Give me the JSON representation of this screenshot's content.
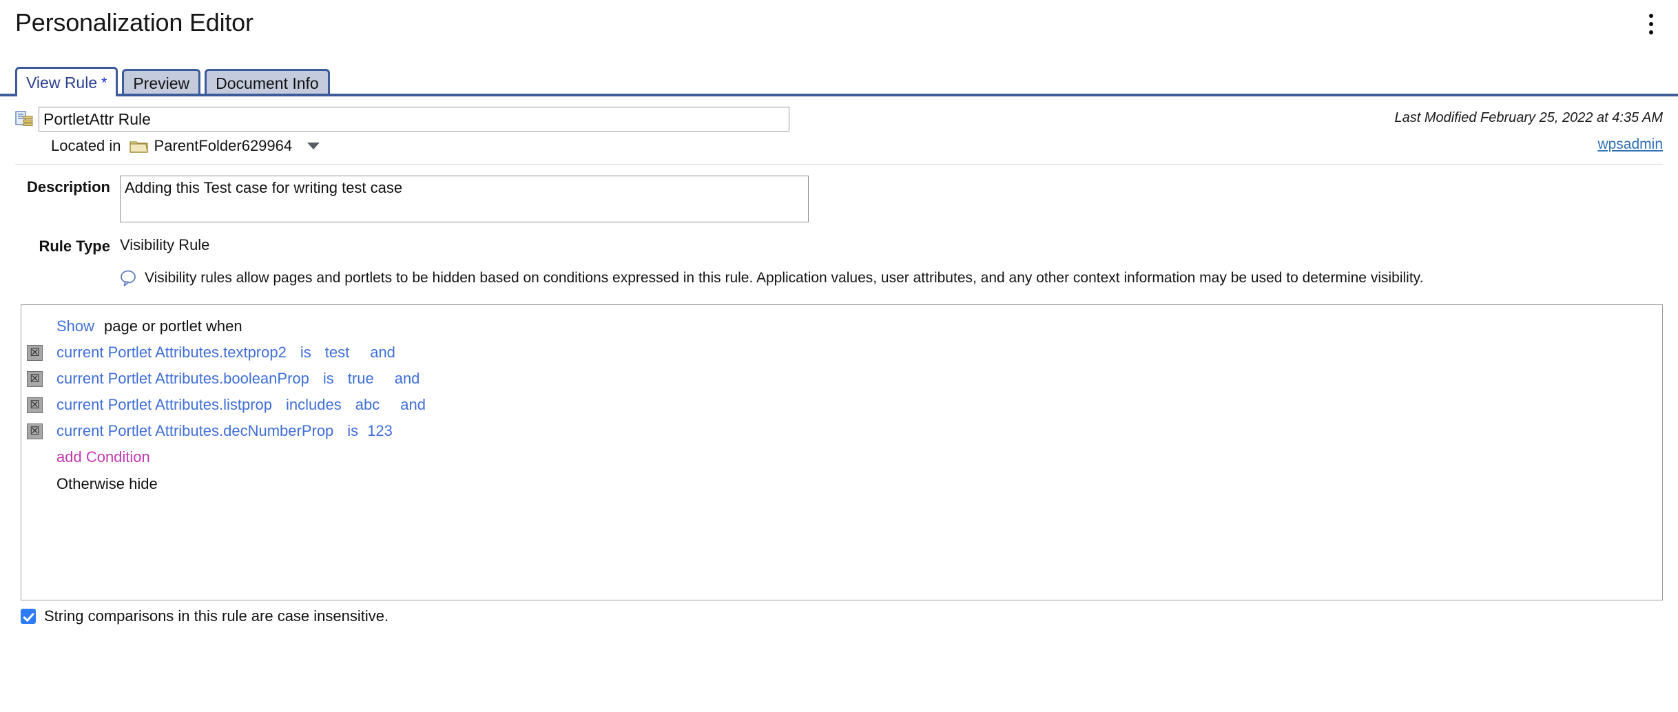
{
  "header": {
    "title": "Personalization Editor",
    "overflow_menu_icon": "kebab-menu-icon"
  },
  "tabs": [
    {
      "label": "View Rule",
      "modified_marker": "*",
      "active": true
    },
    {
      "label": "Preview",
      "active": false
    },
    {
      "label": "Document Info",
      "active": false
    }
  ],
  "meta": {
    "rule_icon": "rule-document-icon",
    "rule_name_value": "PortletAttr Rule",
    "rule_name_placeholder": "Rule name",
    "last_modified": "Last Modified February 25, 2022 at 4:35 AM",
    "located_in_label": "Located in",
    "folder_icon": "folder-icon",
    "folder_name": "ParentFolder629964",
    "folder_caret_icon": "chevron-down-icon",
    "user_link": "wpsadmin"
  },
  "form": {
    "description_label": "Description",
    "description_value": "Adding this Test case for writing test case",
    "description_placeholder": "Description",
    "rule_type_label": "Rule Type",
    "rule_type_value": "Visibility Rule",
    "hint_icon": "callout-bubble-icon",
    "hint_text": "Visibility rules allow pages and portlets to be hidden based on conditions expressed in this rule. Application values, user attributes, and any other context information may be used to determine visibility."
  },
  "rule_builder": {
    "show_label": "Show",
    "show_suffix": "page or portlet when",
    "delete_glyph": "☒",
    "conditions": [
      {
        "attribute": "current Portlet Attributes.textprop2",
        "operator": "is",
        "value": "test",
        "conjunction": "and"
      },
      {
        "attribute": "current Portlet Attributes.booleanProp",
        "operator": "is",
        "value": "true",
        "conjunction": "and"
      },
      {
        "attribute": "current Portlet Attributes.listprop",
        "operator": "includes",
        "value": "abc",
        "conjunction": "and"
      },
      {
        "attribute": "current Portlet Attributes.decNumberProp",
        "operator": "is",
        "value": "123",
        "conjunction": ""
      }
    ],
    "add_condition_label": "add Condition",
    "otherwise_label": "Otherwise hide"
  },
  "footer": {
    "case_insensitive_label": "String comparisons in this rule are case insensitive.",
    "case_insensitive_checked": true
  },
  "colors": {
    "tab_border": "#3d5a9b",
    "tab_inactive_bg": "#c3cbdd",
    "link_blue": "#3f6fd8",
    "add_condition_magenta": "#c537b1",
    "user_link_blue": "#2f6fb5",
    "checkbox_blue": "#2f7bf6"
  }
}
